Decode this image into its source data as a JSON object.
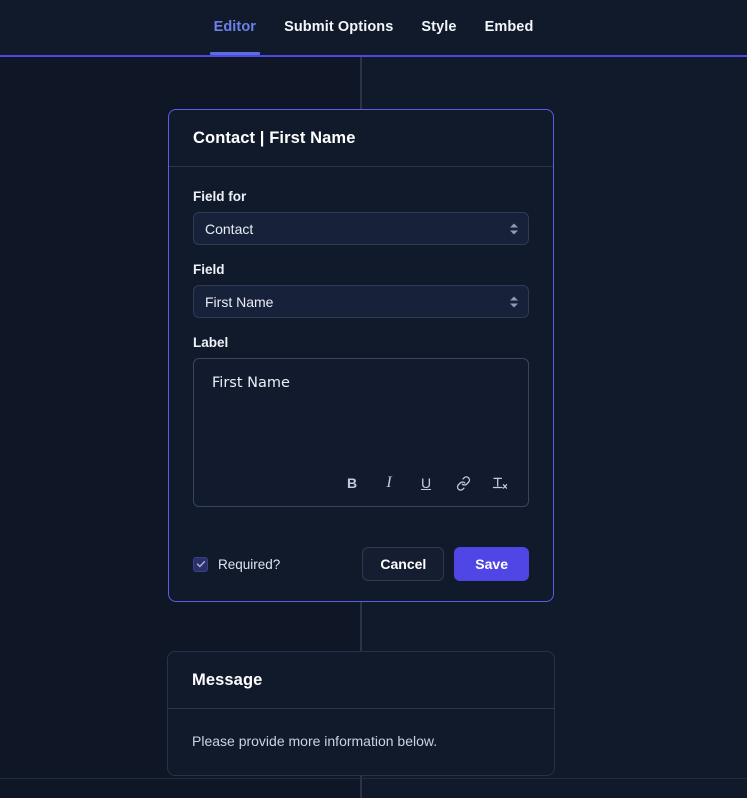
{
  "tabs": [
    {
      "label": "Editor",
      "active": true
    },
    {
      "label": "Submit Options",
      "active": false
    },
    {
      "label": "Style",
      "active": false
    },
    {
      "label": "Embed",
      "active": false
    }
  ],
  "field_card": {
    "title": "Contact | First Name",
    "field_for": {
      "label": "Field for",
      "value": "Contact"
    },
    "field": {
      "label": "Field",
      "value": "First Name"
    },
    "label_editor": {
      "label": "Label",
      "value": "First Name",
      "toolbar": [
        {
          "name": "bold",
          "glyph": "B"
        },
        {
          "name": "italic",
          "glyph": "I"
        },
        {
          "name": "underline",
          "glyph": "U"
        },
        {
          "name": "link",
          "glyph": "link-icon"
        },
        {
          "name": "clear-formatting",
          "glyph": "Tx"
        }
      ]
    },
    "required": {
      "label": "Required?",
      "checked": true
    },
    "cancel_label": "Cancel",
    "save_label": "Save"
  },
  "message_card": {
    "title": "Message",
    "body": "Please provide more information below."
  },
  "colors": {
    "page_background": "#0f1626",
    "panel_background": "#111a2b",
    "accent": "#4f46e5",
    "active_tab": "#6d7fe8",
    "card_active_border": "#5b5ce8",
    "connector_line": "#2a3448",
    "divider": "#2b364c",
    "text_primary": "#ffffff",
    "text_secondary": "#c9d3e2",
    "input_background": "#18213a",
    "input_border": "#2f3b55",
    "checkbox_fill": "#2b2f6b"
  }
}
